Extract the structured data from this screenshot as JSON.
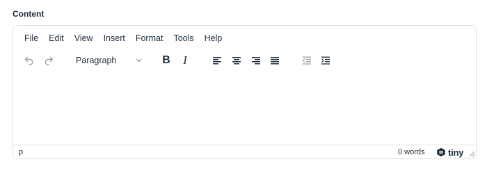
{
  "field": {
    "label": "Content"
  },
  "menubar": [
    {
      "label": "File",
      "name": "menu-file"
    },
    {
      "label": "Edit",
      "name": "menu-edit"
    },
    {
      "label": "View",
      "name": "menu-view"
    },
    {
      "label": "Insert",
      "name": "menu-insert"
    },
    {
      "label": "Format",
      "name": "menu-format"
    },
    {
      "label": "Tools",
      "name": "menu-tools"
    },
    {
      "label": "Help",
      "name": "menu-help"
    }
  ],
  "toolbar": {
    "block_format": "Paragraph",
    "bold_label": "B",
    "italic_label": "I",
    "icons": {
      "undo": "undo-icon",
      "redo": "redo-icon",
      "align_left": "align-left-icon",
      "align_center": "align-center-icon",
      "align_right": "align-right-icon",
      "align_justify": "align-justify-icon",
      "outdent": "outdent-icon",
      "indent": "indent-icon"
    }
  },
  "statusbar": {
    "path": "p",
    "word_count": "0 words",
    "brand": "tiny"
  },
  "colors": {
    "text": "#222f3e",
    "border": "#dddddd",
    "disabled": "#a9aeb4"
  }
}
